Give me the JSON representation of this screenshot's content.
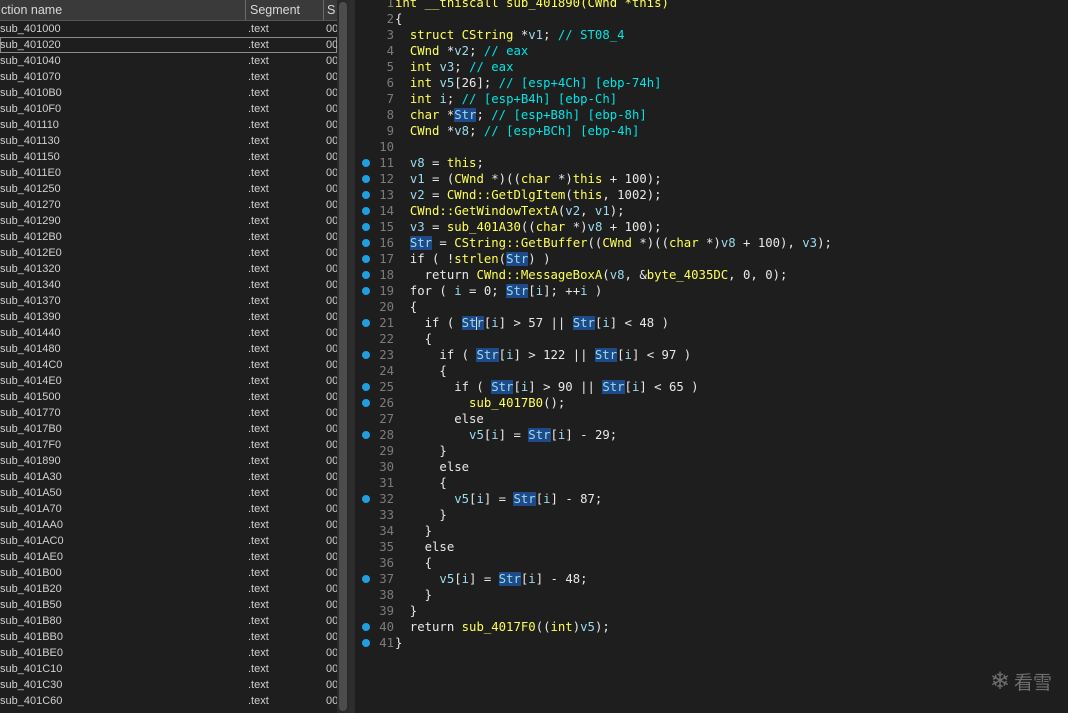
{
  "functions_panel": {
    "columns": [
      "ction name",
      "Segment",
      "S"
    ],
    "selected_index": 1,
    "rows": [
      {
        "name": "sub_401000",
        "segment": ".text",
        "s": "00"
      },
      {
        "name": "sub_401020",
        "segment": ".text",
        "s": "00"
      },
      {
        "name": "sub_401040",
        "segment": ".text",
        "s": "00"
      },
      {
        "name": "sub_401070",
        "segment": ".text",
        "s": "00"
      },
      {
        "name": "sub_4010B0",
        "segment": ".text",
        "s": "00"
      },
      {
        "name": "sub_4010F0",
        "segment": ".text",
        "s": "00"
      },
      {
        "name": "sub_401110",
        "segment": ".text",
        "s": "00"
      },
      {
        "name": "sub_401130",
        "segment": ".text",
        "s": "00"
      },
      {
        "name": "sub_401150",
        "segment": ".text",
        "s": "00"
      },
      {
        "name": "sub_4011E0",
        "segment": ".text",
        "s": "00"
      },
      {
        "name": "sub_401250",
        "segment": ".text",
        "s": "00"
      },
      {
        "name": "sub_401270",
        "segment": ".text",
        "s": "00"
      },
      {
        "name": "sub_401290",
        "segment": ".text",
        "s": "00"
      },
      {
        "name": "sub_4012B0",
        "segment": ".text",
        "s": "00"
      },
      {
        "name": "sub_4012E0",
        "segment": ".text",
        "s": "00"
      },
      {
        "name": "sub_401320",
        "segment": ".text",
        "s": "00"
      },
      {
        "name": "sub_401340",
        "segment": ".text",
        "s": "00"
      },
      {
        "name": "sub_401370",
        "segment": ".text",
        "s": "00"
      },
      {
        "name": "sub_401390",
        "segment": ".text",
        "s": "00"
      },
      {
        "name": "sub_401440",
        "segment": ".text",
        "s": "00"
      },
      {
        "name": "sub_401480",
        "segment": ".text",
        "s": "00"
      },
      {
        "name": "sub_4014C0",
        "segment": ".text",
        "s": "00"
      },
      {
        "name": "sub_4014E0",
        "segment": ".text",
        "s": "00"
      },
      {
        "name": "sub_401500",
        "segment": ".text",
        "s": "00"
      },
      {
        "name": "sub_401770",
        "segment": ".text",
        "s": "00"
      },
      {
        "name": "sub_4017B0",
        "segment": ".text",
        "s": "00"
      },
      {
        "name": "sub_4017F0",
        "segment": ".text",
        "s": "00"
      },
      {
        "name": "sub_401890",
        "segment": ".text",
        "s": "00"
      },
      {
        "name": "sub_401A30",
        "segment": ".text",
        "s": "00"
      },
      {
        "name": "sub_401A50",
        "segment": ".text",
        "s": "00"
      },
      {
        "name": "sub_401A70",
        "segment": ".text",
        "s": "00"
      },
      {
        "name": "sub_401AA0",
        "segment": ".text",
        "s": "00"
      },
      {
        "name": "sub_401AC0",
        "segment": ".text",
        "s": "00"
      },
      {
        "name": "sub_401AE0",
        "segment": ".text",
        "s": "00"
      },
      {
        "name": "sub_401B00",
        "segment": ".text",
        "s": "00"
      },
      {
        "name": "sub_401B20",
        "segment": ".text",
        "s": "00"
      },
      {
        "name": "sub_401B50",
        "segment": ".text",
        "s": "00"
      },
      {
        "name": "sub_401B80",
        "segment": ".text",
        "s": "00"
      },
      {
        "name": "sub_401BB0",
        "segment": ".text",
        "s": "00"
      },
      {
        "name": "sub_401BE0",
        "segment": ".text",
        "s": "00"
      },
      {
        "name": "sub_401C10",
        "segment": ".text",
        "s": "00"
      },
      {
        "name": "sub_401C30",
        "segment": ".text",
        "s": "00"
      },
      {
        "name": "sub_401C60",
        "segment": ".text",
        "s": "00"
      }
    ]
  },
  "pseudocode": {
    "breakpoint_color": "#1f9fe0",
    "highlight_color": "#1e4a8a",
    "lines": [
      {
        "n": "1",
        "dot": false,
        "t": [
          [
            "kw",
            "int __thiscall sub_401890(CWnd *this)"
          ]
        ]
      },
      {
        "n": "2",
        "dot": false,
        "t": [
          [
            "op",
            "{"
          ]
        ]
      },
      {
        "n": "3",
        "dot": false,
        "t": [
          [
            "op",
            "  "
          ],
          [
            "kw",
            "struct CString "
          ],
          [
            "op",
            "*"
          ],
          [
            "id",
            "v1"
          ],
          [
            "op",
            "; "
          ],
          [
            "cm",
            "// ST08_4"
          ]
        ]
      },
      {
        "n": "4",
        "dot": false,
        "t": [
          [
            "op",
            "  "
          ],
          [
            "kw",
            "CWnd "
          ],
          [
            "op",
            "*"
          ],
          [
            "id",
            "v2"
          ],
          [
            "op",
            "; "
          ],
          [
            "cm",
            "// eax"
          ]
        ]
      },
      {
        "n": "5",
        "dot": false,
        "t": [
          [
            "op",
            "  "
          ],
          [
            "kw",
            "int "
          ],
          [
            "id",
            "v3"
          ],
          [
            "op",
            "; "
          ],
          [
            "cm",
            "// eax"
          ]
        ]
      },
      {
        "n": "6",
        "dot": false,
        "t": [
          [
            "op",
            "  "
          ],
          [
            "kw",
            "int "
          ],
          [
            "id",
            "v5"
          ],
          [
            "op",
            "[26]; "
          ],
          [
            "cm",
            "// [esp+4Ch] [ebp-74h]"
          ]
        ]
      },
      {
        "n": "7",
        "dot": false,
        "t": [
          [
            "op",
            "  "
          ],
          [
            "kw",
            "int "
          ],
          [
            "id",
            "i"
          ],
          [
            "op",
            "; "
          ],
          [
            "cm",
            "// [esp+B4h] [ebp-Ch]"
          ]
        ]
      },
      {
        "n": "8",
        "dot": false,
        "t": [
          [
            "op",
            "  "
          ],
          [
            "kw",
            "char "
          ],
          [
            "op",
            "*"
          ],
          [
            "hl",
            "Str"
          ],
          [
            "op",
            "; "
          ],
          [
            "cm",
            "// [esp+B8h] [ebp-8h]"
          ]
        ]
      },
      {
        "n": "9",
        "dot": false,
        "t": [
          [
            "op",
            "  "
          ],
          [
            "kw",
            "CWnd "
          ],
          [
            "op",
            "*"
          ],
          [
            "id",
            "v8"
          ],
          [
            "op",
            "; "
          ],
          [
            "cm",
            "// [esp+BCh] [ebp-4h]"
          ]
        ]
      },
      {
        "n": "10",
        "dot": false,
        "t": []
      },
      {
        "n": "11",
        "dot": true,
        "t": [
          [
            "op",
            "  "
          ],
          [
            "id",
            "v8"
          ],
          [
            "op",
            " = "
          ],
          [
            "kw",
            "this"
          ],
          [
            "op",
            ";"
          ]
        ]
      },
      {
        "n": "12",
        "dot": true,
        "t": [
          [
            "op",
            "  "
          ],
          [
            "id",
            "v1"
          ],
          [
            "op",
            " = ("
          ],
          [
            "kw",
            "CWnd "
          ],
          [
            "op",
            "*)(("
          ],
          [
            "kw",
            "char "
          ],
          [
            "op",
            "*)"
          ],
          [
            "kw",
            "this"
          ],
          [
            "op",
            " + 100);"
          ]
        ]
      },
      {
        "n": "13",
        "dot": true,
        "t": [
          [
            "op",
            "  "
          ],
          [
            "id",
            "v2"
          ],
          [
            "op",
            " = "
          ],
          [
            "fn",
            "CWnd::GetDlgItem"
          ],
          [
            "op",
            "("
          ],
          [
            "kw",
            "this"
          ],
          [
            "op",
            ", 1002);"
          ]
        ]
      },
      {
        "n": "14",
        "dot": true,
        "t": [
          [
            "op",
            "  "
          ],
          [
            "fn",
            "CWnd::GetWindowTextA"
          ],
          [
            "op",
            "("
          ],
          [
            "id",
            "v2"
          ],
          [
            "op",
            ", "
          ],
          [
            "id",
            "v1"
          ],
          [
            "op",
            ");"
          ]
        ]
      },
      {
        "n": "15",
        "dot": true,
        "t": [
          [
            "op",
            "  "
          ],
          [
            "id",
            "v3"
          ],
          [
            "op",
            " = "
          ],
          [
            "fn",
            "sub_401A30"
          ],
          [
            "op",
            "(("
          ],
          [
            "kw",
            "char "
          ],
          [
            "op",
            "*)"
          ],
          [
            "id",
            "v8"
          ],
          [
            "op",
            " + 100);"
          ]
        ]
      },
      {
        "n": "16",
        "dot": true,
        "t": [
          [
            "op",
            "  "
          ],
          [
            "hl",
            "Str"
          ],
          [
            "op",
            " = "
          ],
          [
            "fn",
            "CString::GetBuffer"
          ],
          [
            "op",
            "(("
          ],
          [
            "kw",
            "CWnd "
          ],
          [
            "op",
            "*)(("
          ],
          [
            "kw",
            "char "
          ],
          [
            "op",
            "*)"
          ],
          [
            "id",
            "v8"
          ],
          [
            "op",
            " + 100), "
          ],
          [
            "id",
            "v3"
          ],
          [
            "op",
            ");"
          ]
        ]
      },
      {
        "n": "17",
        "dot": true,
        "t": [
          [
            "op",
            "  if ( !"
          ],
          [
            "fn",
            "strlen"
          ],
          [
            "op",
            "("
          ],
          [
            "hl",
            "Str"
          ],
          [
            "op",
            ") )"
          ]
        ]
      },
      {
        "n": "18",
        "dot": true,
        "t": [
          [
            "op",
            "    return "
          ],
          [
            "fn",
            "CWnd::MessageBoxA"
          ],
          [
            "op",
            "("
          ],
          [
            "id",
            "v8"
          ],
          [
            "op",
            ", &"
          ],
          [
            "fn",
            "byte_4035DC"
          ],
          [
            "op",
            ", 0, 0);"
          ]
        ]
      },
      {
        "n": "19",
        "dot": true,
        "t": [
          [
            "op",
            "  for ( "
          ],
          [
            "id",
            "i"
          ],
          [
            "op",
            " = 0; "
          ],
          [
            "hl",
            "Str"
          ],
          [
            "op",
            "["
          ],
          [
            "id",
            "i"
          ],
          [
            "op",
            "]; ++"
          ],
          [
            "id",
            "i"
          ],
          [
            "op",
            " )"
          ]
        ]
      },
      {
        "n": "20",
        "dot": false,
        "t": [
          [
            "op",
            "  {"
          ]
        ]
      },
      {
        "n": "21",
        "dot": true,
        "t": [
          [
            "op",
            "    if ( "
          ],
          [
            "hlc",
            "Str"
          ],
          [
            "op",
            "["
          ],
          [
            "id",
            "i"
          ],
          [
            "op",
            "] > 57 || "
          ],
          [
            "hl",
            "Str"
          ],
          [
            "op",
            "["
          ],
          [
            "id",
            "i"
          ],
          [
            "op",
            "] < 48 )"
          ]
        ]
      },
      {
        "n": "22",
        "dot": false,
        "t": [
          [
            "op",
            "    {"
          ]
        ]
      },
      {
        "n": "23",
        "dot": true,
        "t": [
          [
            "op",
            "      if ( "
          ],
          [
            "hl",
            "Str"
          ],
          [
            "op",
            "["
          ],
          [
            "id",
            "i"
          ],
          [
            "op",
            "] > 122 || "
          ],
          [
            "hl",
            "Str"
          ],
          [
            "op",
            "["
          ],
          [
            "id",
            "i"
          ],
          [
            "op",
            "] < 97 )"
          ]
        ]
      },
      {
        "n": "24",
        "dot": false,
        "t": [
          [
            "op",
            "      {"
          ]
        ]
      },
      {
        "n": "25",
        "dot": true,
        "t": [
          [
            "op",
            "        if ( "
          ],
          [
            "hl",
            "Str"
          ],
          [
            "op",
            "["
          ],
          [
            "id",
            "i"
          ],
          [
            "op",
            "] > 90 || "
          ],
          [
            "hl",
            "Str"
          ],
          [
            "op",
            "["
          ],
          [
            "id",
            "i"
          ],
          [
            "op",
            "] < 65 )"
          ]
        ]
      },
      {
        "n": "26",
        "dot": true,
        "t": [
          [
            "op",
            "          "
          ],
          [
            "fn",
            "sub_4017B0"
          ],
          [
            "op",
            "();"
          ]
        ]
      },
      {
        "n": "27",
        "dot": false,
        "t": [
          [
            "op",
            "        else"
          ]
        ]
      },
      {
        "n": "28",
        "dot": true,
        "t": [
          [
            "op",
            "          "
          ],
          [
            "id",
            "v5"
          ],
          [
            "op",
            "["
          ],
          [
            "id",
            "i"
          ],
          [
            "op",
            "] = "
          ],
          [
            "hl",
            "Str"
          ],
          [
            "op",
            "["
          ],
          [
            "id",
            "i"
          ],
          [
            "op",
            "] - 29;"
          ]
        ]
      },
      {
        "n": "29",
        "dot": false,
        "t": [
          [
            "op",
            "      }"
          ]
        ]
      },
      {
        "n": "30",
        "dot": false,
        "t": [
          [
            "op",
            "      else"
          ]
        ]
      },
      {
        "n": "31",
        "dot": false,
        "t": [
          [
            "op",
            "      {"
          ]
        ]
      },
      {
        "n": "32",
        "dot": true,
        "t": [
          [
            "op",
            "        "
          ],
          [
            "id",
            "v5"
          ],
          [
            "op",
            "["
          ],
          [
            "id",
            "i"
          ],
          [
            "op",
            "] = "
          ],
          [
            "hl",
            "Str"
          ],
          [
            "op",
            "["
          ],
          [
            "id",
            "i"
          ],
          [
            "op",
            "] - 87;"
          ]
        ]
      },
      {
        "n": "33",
        "dot": false,
        "t": [
          [
            "op",
            "      }"
          ]
        ]
      },
      {
        "n": "34",
        "dot": false,
        "t": [
          [
            "op",
            "    }"
          ]
        ]
      },
      {
        "n": "35",
        "dot": false,
        "t": [
          [
            "op",
            "    else"
          ]
        ]
      },
      {
        "n": "36",
        "dot": false,
        "t": [
          [
            "op",
            "    {"
          ]
        ]
      },
      {
        "n": "37",
        "dot": true,
        "t": [
          [
            "op",
            "      "
          ],
          [
            "id",
            "v5"
          ],
          [
            "op",
            "["
          ],
          [
            "id",
            "i"
          ],
          [
            "op",
            "] = "
          ],
          [
            "hl",
            "Str"
          ],
          [
            "op",
            "["
          ],
          [
            "id",
            "i"
          ],
          [
            "op",
            "] - 48;"
          ]
        ]
      },
      {
        "n": "38",
        "dot": false,
        "t": [
          [
            "op",
            "    }"
          ]
        ]
      },
      {
        "n": "39",
        "dot": false,
        "t": [
          [
            "op",
            "  }"
          ]
        ]
      },
      {
        "n": "40",
        "dot": true,
        "t": [
          [
            "op",
            "  return "
          ],
          [
            "fn",
            "sub_4017F0"
          ],
          [
            "op",
            "(("
          ],
          [
            "kw",
            "int"
          ],
          [
            "op",
            ")"
          ],
          [
            "id",
            "v5"
          ],
          [
            "op",
            ");"
          ]
        ]
      },
      {
        "n": "41",
        "dot": true,
        "t": [
          [
            "op",
            "}"
          ]
        ]
      }
    ]
  },
  "watermark": {
    "text": "看雪",
    "icon": "snowflake-icon"
  }
}
